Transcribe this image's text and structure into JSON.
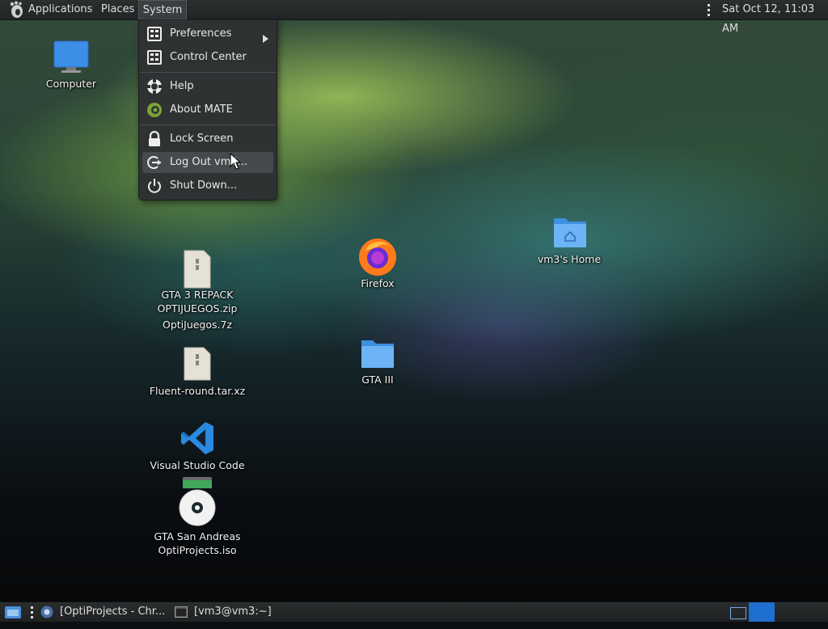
{
  "top_panel": {
    "applications": "Applications",
    "places": "Places",
    "system": "System",
    "clock": "Sat Oct 12, 11:03 AM"
  },
  "system_menu": {
    "preferences": "Preferences",
    "control_center": "Control Center",
    "help": "Help",
    "about": "About MATE",
    "lock": "Lock Screen",
    "logout": "Log Out vm3...",
    "shutdown": "Shut Down..."
  },
  "desktop": {
    "computer": "Computer",
    "gta3_line1": "GTA 3 REPACK",
    "gta3_line2": "OPTIJUEGOS.zip",
    "gta3_line3": "OptiJuegos.7z",
    "fluent": "Fluent-round.tar.xz",
    "vscode": "Visual Studio Code",
    "gta_sa_line1": "GTA San Andreas",
    "gta_sa_line2": "OptiProjects.iso",
    "firefox": "Firefox",
    "gta_iii": "GTA III",
    "home": "vm3's Home"
  },
  "bottom_panel": {
    "task1": "[OptiProjects - Chr...",
    "task2": "[vm3@vm3:~]"
  },
  "colors": {
    "panel": "#2b2e2f",
    "menu_bg": "#2f3233",
    "menu_hover": "#454a4c",
    "folder_blue": "#5aa9f0",
    "workspace_active": "#1f6fd0"
  }
}
